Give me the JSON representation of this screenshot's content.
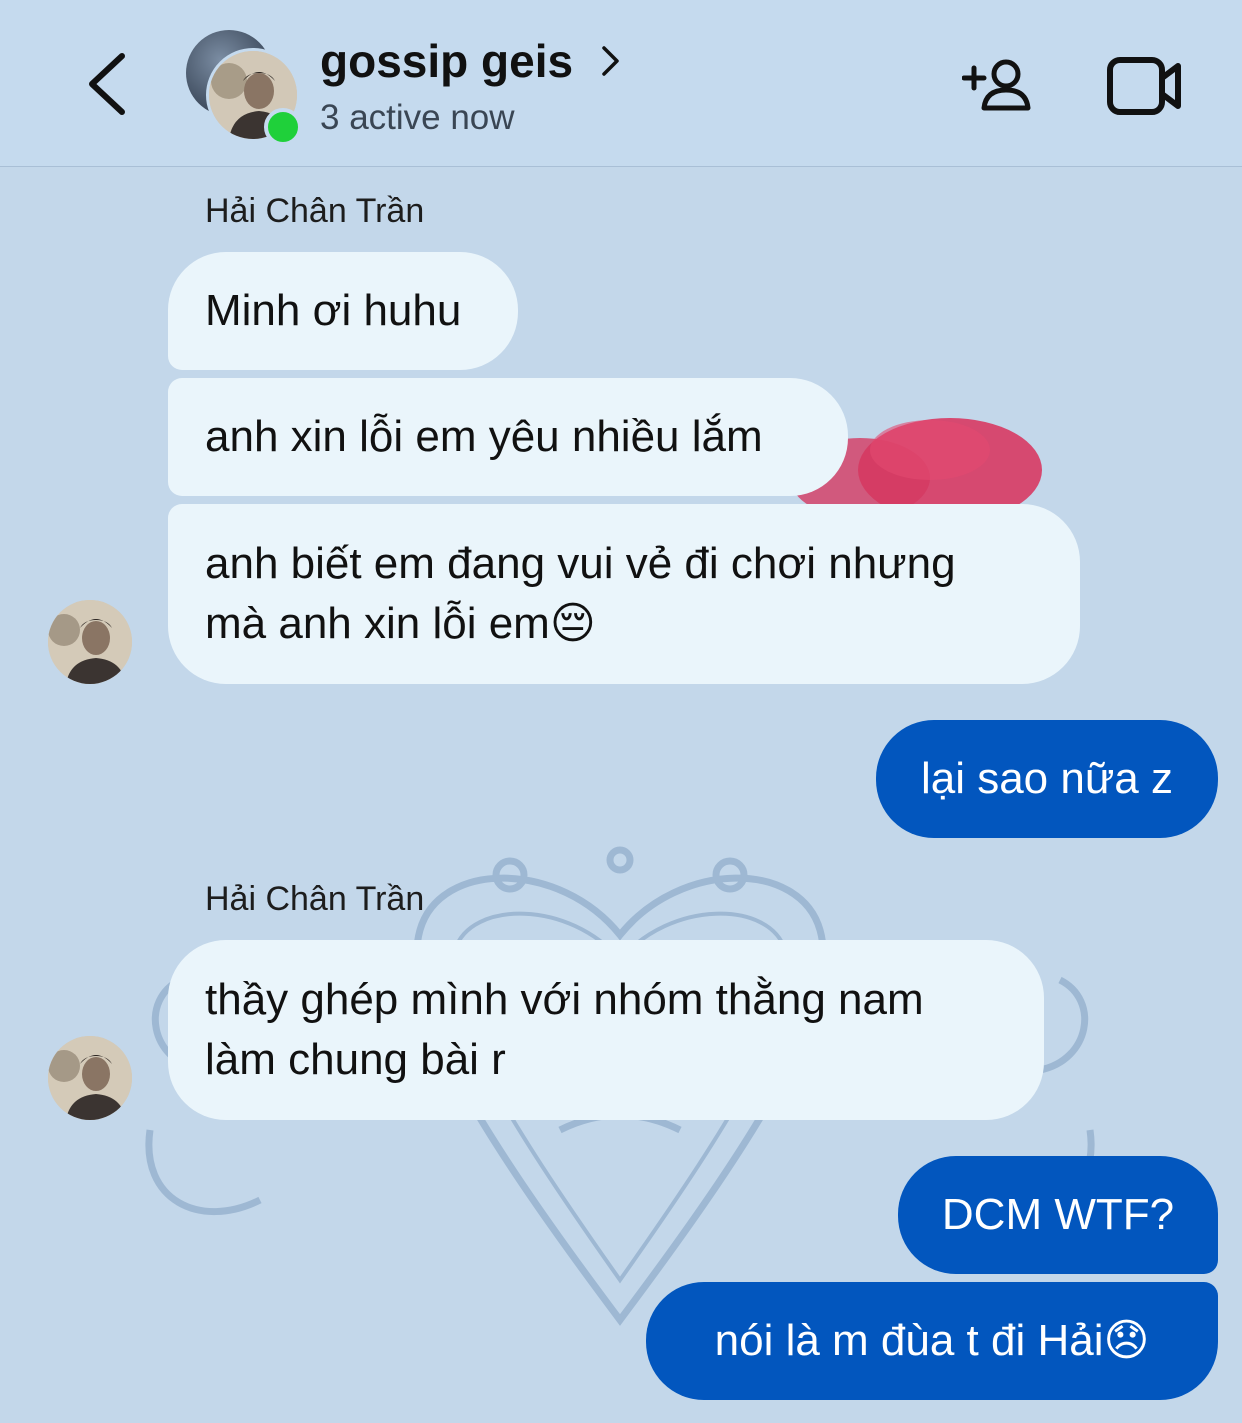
{
  "header": {
    "chat_title": "gossip geis",
    "active_status": "3 active now"
  },
  "colors": {
    "background": "#c3d7ea",
    "incoming_bubble": "#eaf5fb",
    "outgoing_bubble": "#0256be",
    "online_dot": "#1fd03a"
  },
  "messages": [
    {
      "type": "sender",
      "text": "Hải Chân Trần"
    },
    {
      "type": "incoming",
      "text": "Minh ơi huhu"
    },
    {
      "type": "incoming",
      "text": "anh xin lỗi em yêu nhiều lắm"
    },
    {
      "type": "incoming",
      "text": "anh biết em đang vui vẻ đi chơi nhưng\nmà anh xin lỗi em😔"
    },
    {
      "type": "outgoing",
      "text": "lại sao nữa z"
    },
    {
      "type": "sender",
      "text": "Hải Chân Trần"
    },
    {
      "type": "incoming",
      "text": "thầy ghép mình với nhóm thằng nam\nlàm chung bài r"
    },
    {
      "type": "outgoing",
      "text": "DCM WTF?"
    },
    {
      "type": "outgoing",
      "text": "nói là m đùa t đi Hải😞"
    }
  ],
  "icons": {
    "back": "chevron-left-icon",
    "title_chevron": "chevron-right-icon",
    "add_person": "add-person-icon",
    "video": "video-camera-icon"
  }
}
